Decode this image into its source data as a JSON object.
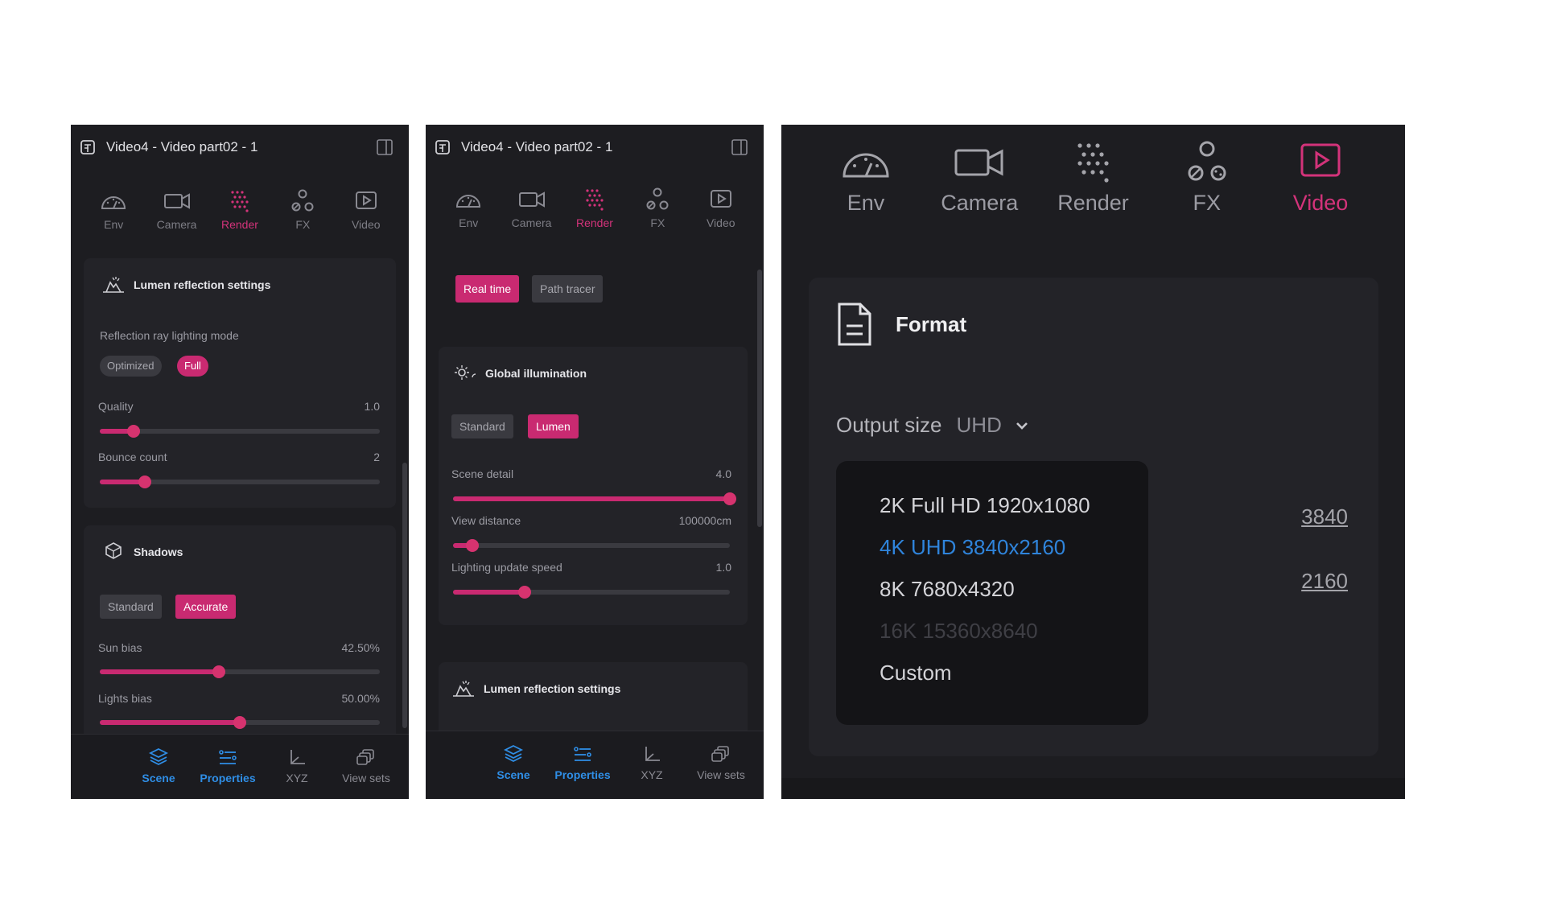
{
  "panels": [
    {
      "title": "Video4 - Video part02 - 1",
      "tabs": [
        {
          "label": "Env",
          "icon": "gauge-icon"
        },
        {
          "label": "Camera",
          "icon": "camera-icon"
        },
        {
          "label": "Render",
          "icon": "render-dots-icon",
          "active": true
        },
        {
          "label": "FX",
          "icon": "fx-icon"
        },
        {
          "label": "Video",
          "icon": "video-icon"
        }
      ],
      "lumen": {
        "title": "Lumen reflection settings",
        "mode_label": "Reflection ray lighting mode",
        "mode_options": [
          "Optimized",
          "Full"
        ],
        "mode_selected": "Full",
        "quality": {
          "label": "Quality",
          "value": "1.0",
          "fraction": 0.12
        },
        "bounce": {
          "label": "Bounce count",
          "value": "2",
          "fraction": 0.16
        }
      },
      "shadows": {
        "title": "Shadows",
        "options": [
          "Standard",
          "Accurate"
        ],
        "selected": "Accurate",
        "sun_bias": {
          "label": "Sun bias",
          "value": "42.50%",
          "fraction": 0.425
        },
        "lights_bias": {
          "label": "Lights bias",
          "value": "50.00%",
          "fraction": 0.5
        }
      }
    },
    {
      "title": "Video4 - Video part02 - 1",
      "mode_options": [
        "Real time",
        "Path tracer"
      ],
      "mode_selected": "Real time",
      "gi": {
        "title": "Global illumination",
        "options": [
          "Standard",
          "Lumen"
        ],
        "selected": "Lumen",
        "scene_detail": {
          "label": "Scene detail",
          "value": "4.0",
          "fraction": 1.0
        },
        "view_distance": {
          "label": "View distance",
          "value": "100000cm",
          "fraction": 0.07
        },
        "lighting_speed": {
          "label": "Lighting update speed",
          "value": "1.0",
          "fraction": 0.26
        }
      },
      "lumen_title": "Lumen reflection settings"
    },
    {
      "tabs": [
        "Env",
        "Camera",
        "Render",
        "FX",
        "Video"
      ],
      "active_tab": "Video",
      "format_title": "Format",
      "output_size_label": "Output size",
      "output_size_value": "UHD",
      "options": [
        "2K Full HD 1920x1080",
        "4K UHD 3840x2160",
        "8K 7680x4320",
        "16K 15360x8640",
        "Custom"
      ],
      "selected_option": "4K UHD 3840x2160",
      "disabled_option": "16K 15360x8640",
      "width": "3840",
      "height": "2160"
    }
  ],
  "bottom_nav": [
    {
      "label": "Scene",
      "icon": "layers-icon",
      "active": true
    },
    {
      "label": "Properties",
      "icon": "properties-icon",
      "active": true
    },
    {
      "label": "XYZ",
      "icon": "axes-icon",
      "active": false
    },
    {
      "label": "View sets",
      "icon": "view-sets-icon",
      "active": false
    }
  ],
  "colors": {
    "accent": "#c92a71",
    "selected_blue": "#2f84db",
    "panel_bg": "#1d1d21",
    "card_bg": "#232328"
  }
}
